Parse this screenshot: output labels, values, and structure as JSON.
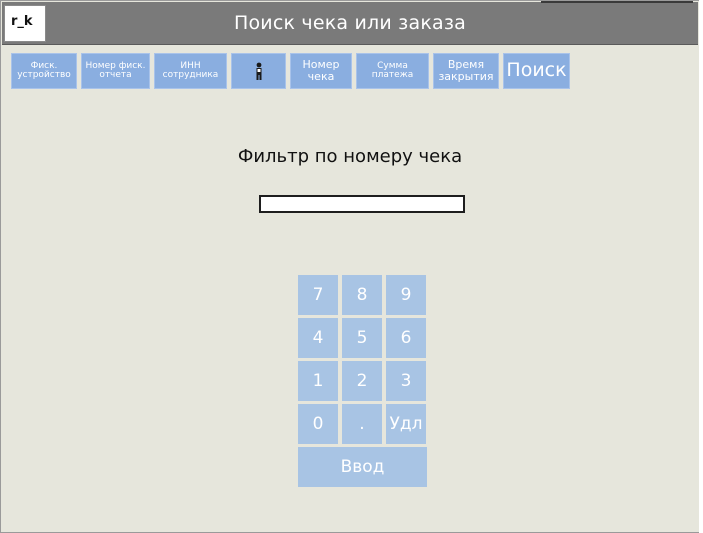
{
  "app_label": "r_k",
  "title": "Поиск чека или заказа",
  "tabs": [
    {
      "label": "Фиск.\nустройство"
    },
    {
      "label": "Номер фиск.\nотчета"
    },
    {
      "label": "ИНН\nсотрудника"
    },
    {
      "icon": "person-icon",
      "label": ""
    },
    {
      "label": "Номер\nчека"
    },
    {
      "label": "Сумма\nплатежа"
    },
    {
      "label": "Время\nзакрытия"
    },
    {
      "label": "Поиск"
    }
  ],
  "filter": {
    "label": "Фильтр по номеру чека",
    "value": "",
    "placeholder": ""
  },
  "keypad": {
    "keys": [
      "7",
      "8",
      "9",
      "4",
      "5",
      "6",
      "1",
      "2",
      "3",
      "0",
      ".",
      "Удл"
    ],
    "enter": "Ввод"
  },
  "colors": {
    "titlebar": "#7a7a7a",
    "tab": "#8aaee0",
    "key": "#a8c4e4",
    "background": "#e6e6dc"
  }
}
